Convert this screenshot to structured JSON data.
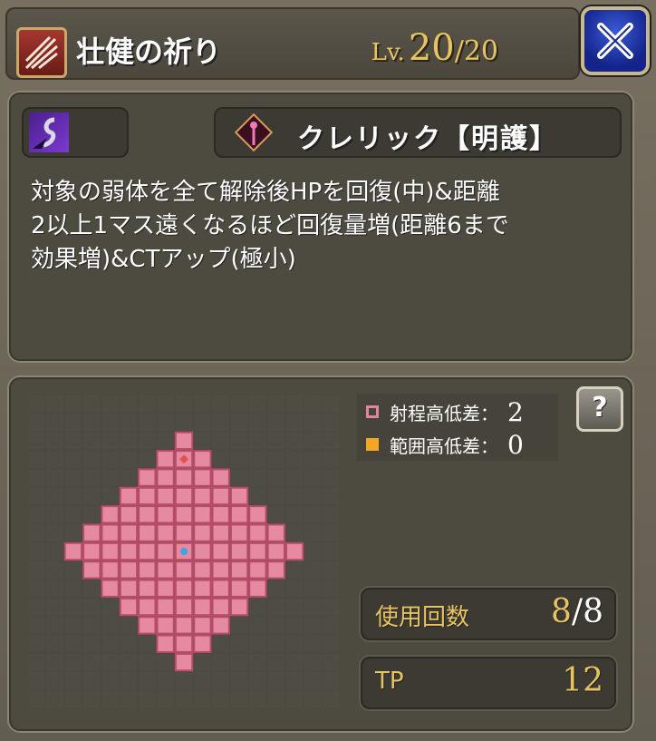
{
  "header": {
    "skill_icon": "claw-slash-icon",
    "title": "壮健の祈り",
    "level_label": "Lv.",
    "level_current": "20",
    "level_max": "/20",
    "close_icon": "close-x-icon"
  },
  "description_panel": {
    "element_icon": "dark-element-icon",
    "class_icon": "staff-icon",
    "class_name": "クレリック【明護】",
    "description_lines": [
      "対象の弱体を全て解除後HPを回復(中)&距離",
      "2以上1マス遠くなるほど回復量増(距離6まで",
      "効果増)&CTアップ(極小)"
    ]
  },
  "range_panel": {
    "grid": {
      "cols": 17,
      "rows": 17,
      "center_cell": [
        8,
        8
      ],
      "origin_marker_cell": [
        8,
        3
      ],
      "range_shape": "diamond radius 6 around center, plus single cells at top (8,2) and bottom (8,14)"
    },
    "legend": {
      "range_height_label": "射程高低差：",
      "range_height_value": "2",
      "range_height_color": "#e2849a",
      "area_height_label": "範囲高低差：",
      "area_height_value": "0",
      "area_height_color": "#f2a826"
    },
    "help_icon": "question-book-icon",
    "help_label": "?",
    "uses_label": "使用回数",
    "uses_current": "8",
    "uses_max": "/8",
    "tp_label": "TP",
    "tp_value": "12"
  },
  "colors": {
    "range_cell": "#e58aa0",
    "range_cell_border": "#b64c69",
    "empty_cell": "#4f4c43",
    "center_cell": "#38a6e8",
    "origin_cell": "#e6504a",
    "accent_gold": "#e8c460"
  }
}
